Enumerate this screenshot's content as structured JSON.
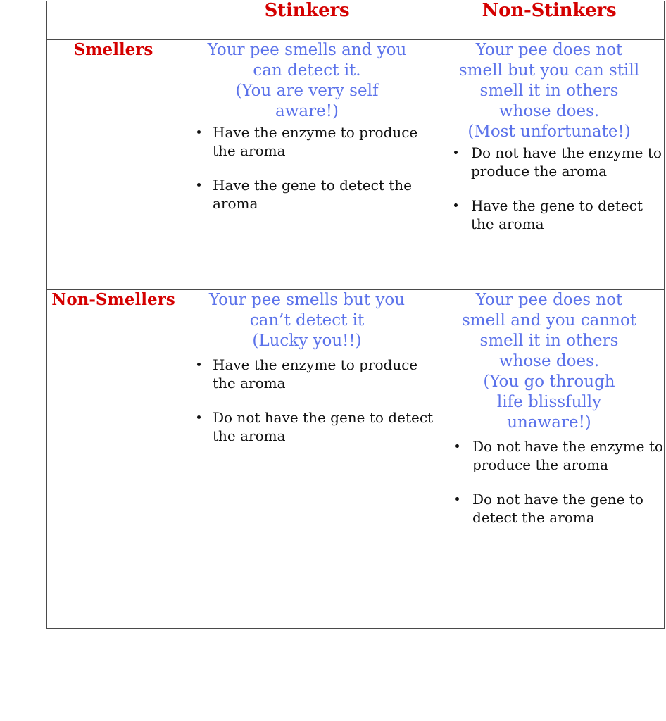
{
  "table": {
    "column_headers": [
      "",
      "Stinkers",
      "Non-Stinkers"
    ],
    "row_headers": [
      "Smellers",
      "Non-Smellers"
    ],
    "colors": {
      "header_red": "#d40000",
      "summary_blue": "#5b72ea",
      "bullet_black": "#111111",
      "border_gray": "#4a4a4a",
      "background": "#ffffff"
    },
    "cells": {
      "smellers_stinkers": {
        "summary_lines": [
          "Your pee smells and you",
          "can detect it.",
          "(You are very self",
          "aware!)"
        ],
        "bullets": [
          "Have the enzyme to produce the aroma",
          "Have the gene to detect the aroma"
        ]
      },
      "smellers_nonstinkers": {
        "summary_lines": [
          "Your pee does not",
          "smell but you can still",
          "smell it in others",
          "whose does.",
          "(Most unfortunate!)"
        ],
        "bullets": [
          "Do not have the enzyme to produce the aroma",
          "Have the gene to detect the aroma"
        ]
      },
      "nonsmellers_stinkers": {
        "summary_lines": [
          "Your pee smells but you",
          "can’t detect it",
          "(Lucky you!!)"
        ],
        "bullets": [
          "Have the enzyme to produce the aroma",
          "Do not have the gene to detect the aroma"
        ]
      },
      "nonsmellers_nonstinkers": {
        "summary_lines": [
          "Your pee does not",
          "smell and you cannot",
          "smell it in others",
          "whose does.",
          "(You go through",
          "life blissfully",
          "unaware!)"
        ],
        "bullets": [
          "Do not have the enzyme to produce the aroma",
          "Do not have the gene to detect the aroma"
        ]
      }
    }
  }
}
